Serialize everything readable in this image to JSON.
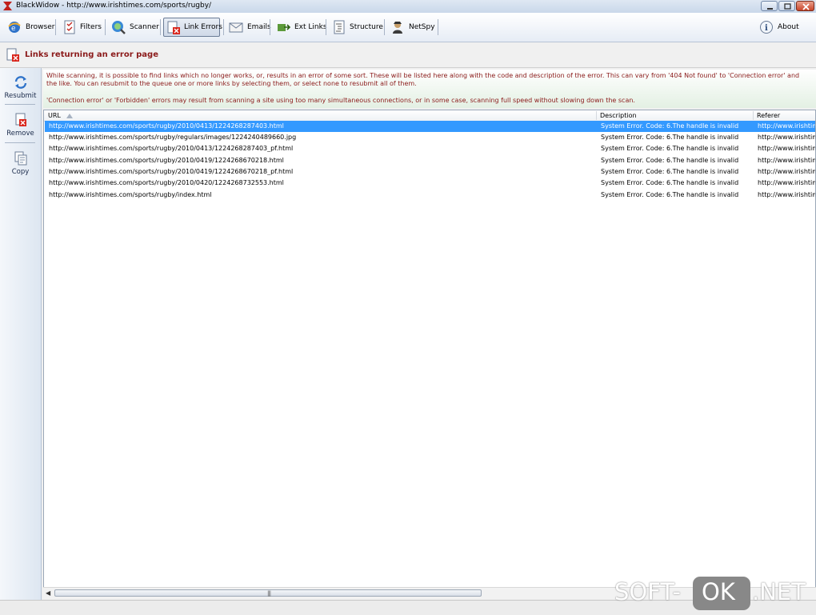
{
  "window": {
    "title": "BlackWidow - http://www.irishtimes.com/sports/rugby/"
  },
  "toolbar": {
    "items": [
      {
        "label": "Browser",
        "icon": "browser-icon"
      },
      {
        "label": "Filters",
        "icon": "filters-icon"
      },
      {
        "label": "Scanner",
        "icon": "scanner-icon"
      },
      {
        "label": "Link Errors",
        "icon": "link-errors-icon",
        "active": true
      },
      {
        "label": "Emails",
        "icon": "emails-icon"
      },
      {
        "label": "Ext Links",
        "icon": "ext-links-icon"
      },
      {
        "label": "Structure",
        "icon": "structure-icon"
      },
      {
        "label": "NetSpy",
        "icon": "netspy-icon"
      }
    ],
    "about_label": "About"
  },
  "section": {
    "title": "Links returning an error page"
  },
  "sidebar": {
    "items": [
      {
        "label": "Resubmit",
        "icon": "resubmit-icon"
      },
      {
        "label": "Remove",
        "icon": "remove-icon"
      },
      {
        "label": "Copy",
        "icon": "copy-icon"
      }
    ]
  },
  "info": {
    "paragraph1": "While scanning, it is possible to find links which no longer works, or, results in an error of some sort. These will be listed here along with the code and description of the error. This can vary from '404 Not found' to 'Connection error' and the like. You can resubmit to the queue one or more links by selecting them, or select none to resubmit all of them.",
    "paragraph2": "'Connection error' or 'Forbidden' errors may result from scanning a site using too many simultaneous connections, or in some case, scanning full speed without slowing down the scan."
  },
  "table": {
    "columns": [
      "URL",
      "Description",
      "Referer"
    ],
    "rows": [
      {
        "url": "http://www.irishtimes.com/sports/rugby/2010/0413/1224268287403.html",
        "description": "System Error.  Code: 6.The handle is invalid",
        "referer": "http://www.irishtimes.com/sports/rugby/"
      },
      {
        "url": "http://www.irishtimes.com/sports/rugby/regulars/images/1224240489660.jpg",
        "description": "System Error.  Code: 6.The handle is invalid",
        "referer": "http://www.irishtimes.com/sports/rugby/"
      },
      {
        "url": "http://www.irishtimes.com/sports/rugby/2010/0413/1224268287403_pf.html",
        "description": "System Error.  Code: 6.The handle is invalid",
        "referer": "http://www.irishtimes.com/sports/rugby/"
      },
      {
        "url": "http://www.irishtimes.com/sports/rugby/2010/0419/1224268670218.html",
        "description": "System Error.  Code: 6.The handle is invalid",
        "referer": "http://www.irishtimes.com/sports/rugby/"
      },
      {
        "url": "http://www.irishtimes.com/sports/rugby/2010/0419/1224268670218_pf.html",
        "description": "System Error.  Code: 6.The handle is invalid",
        "referer": "http://www.irishtimes.com/sports/rugby/"
      },
      {
        "url": "http://www.irishtimes.com/sports/rugby/2010/0420/1224268732553.html",
        "description": "System Error.  Code: 6.The handle is invalid",
        "referer": "http://www.irishtimes.com/sports/rugby/"
      },
      {
        "url": "http://www.irishtimes.com/sports/rugby/index.html",
        "description": "System Error.  Code: 6.The handle is invalid",
        "referer": "http://www.irishtimes.com/sports/rugby/"
      }
    ],
    "selected_row": 0
  },
  "watermark": {
    "left": "SOFT-",
    "middle": "OK",
    "right": ".NET"
  },
  "colors": {
    "selection": "#3399ff",
    "info_text": "#8b1a1a",
    "section_title": "#8b1a1a"
  }
}
